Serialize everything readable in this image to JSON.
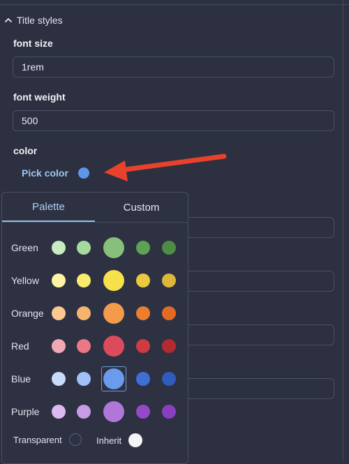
{
  "section": {
    "title": "Title styles"
  },
  "fields": {
    "font_size": {
      "label": "font size",
      "value": "1rem"
    },
    "font_weight": {
      "label": "font weight",
      "value": "500"
    },
    "color": {
      "label": "color",
      "pick_label": "Pick color",
      "current": "#5f96ea"
    }
  },
  "picker": {
    "tabs": [
      {
        "label": "Palette",
        "active": true
      },
      {
        "label": "Custom",
        "active": false
      }
    ],
    "selected": {
      "row": 4,
      "index": 2
    },
    "rows": [
      {
        "name": "Green",
        "colors": [
          "#c9ecc3",
          "#a5db9c",
          "#86c07a",
          "#5ea155",
          "#4f8c45"
        ]
      },
      {
        "name": "Yellow",
        "colors": [
          "#fff4a6",
          "#fbeb6c",
          "#f7e14a",
          "#eac93f",
          "#ddb73a"
        ]
      },
      {
        "name": "Orange",
        "colors": [
          "#fbc88f",
          "#f7b46d",
          "#f39b4b",
          "#ec7e2e",
          "#e46a24"
        ]
      },
      {
        "name": "Red",
        "colors": [
          "#f2a8b3",
          "#eb7887",
          "#dc4b5c",
          "#cf3a43",
          "#b32a30"
        ]
      },
      {
        "name": "Blue",
        "colors": [
          "#c8dbfb",
          "#a2c1f7",
          "#6a9bec",
          "#3d6fd4",
          "#2f5cbd"
        ]
      },
      {
        "name": "Purple",
        "colors": [
          "#dbbaf1",
          "#c89be6",
          "#ae77d9",
          "#9449c8",
          "#8a3fbf"
        ]
      }
    ],
    "special": [
      {
        "label": "Transparent",
        "kind": "transparent"
      },
      {
        "label": "Inherit",
        "kind": "white",
        "color": "#f4f5f7"
      }
    ]
  },
  "annotation": {
    "arrow_color": "#e8412c"
  }
}
